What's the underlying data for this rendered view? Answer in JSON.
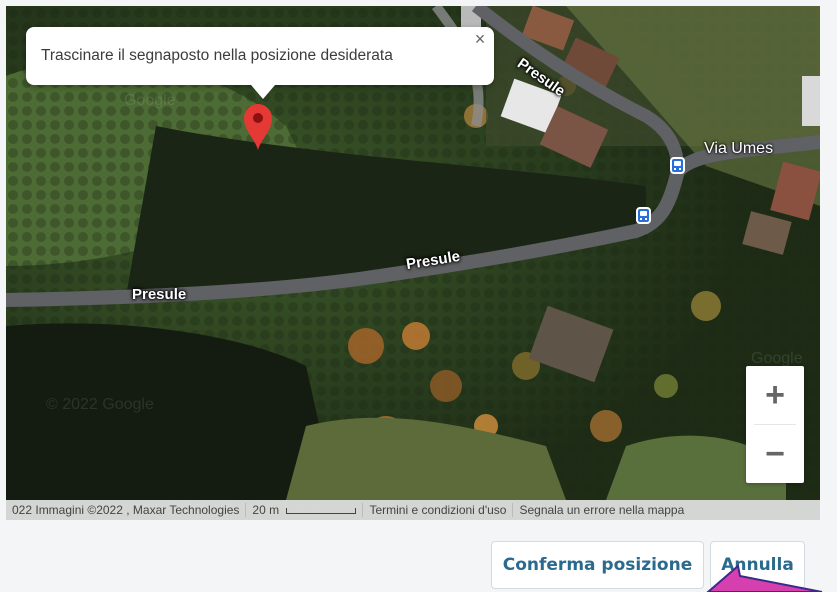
{
  "popup": {
    "message": "Trascinare il segnaposto nella posizione desiderata",
    "close_symbol": "×"
  },
  "map": {
    "road_labels": [
      "Presule",
      "Presule",
      "Presule"
    ],
    "street_label": "Via Umes",
    "watermarks": [
      "Google",
      "© 2022 Google",
      "Google"
    ],
    "marker_color": "#e53935",
    "transit_icons": [
      "bus-stop-icon",
      "bus-stop-icon"
    ]
  },
  "zoom": {
    "in_label": "+",
    "out_label": "−"
  },
  "attribution": {
    "imagery": "022 Immagini ©2022 , Maxar Technologies",
    "scale": "20 m",
    "terms": "Termini e condizioni d'uso",
    "report": "Segnala un errore nella mappa"
  },
  "actions": {
    "confirm_label": "Conferma posizione",
    "cancel_label": "Annulla"
  },
  "colors": {
    "button_text": "#2a6a8e",
    "arrow": "#d63fae"
  }
}
